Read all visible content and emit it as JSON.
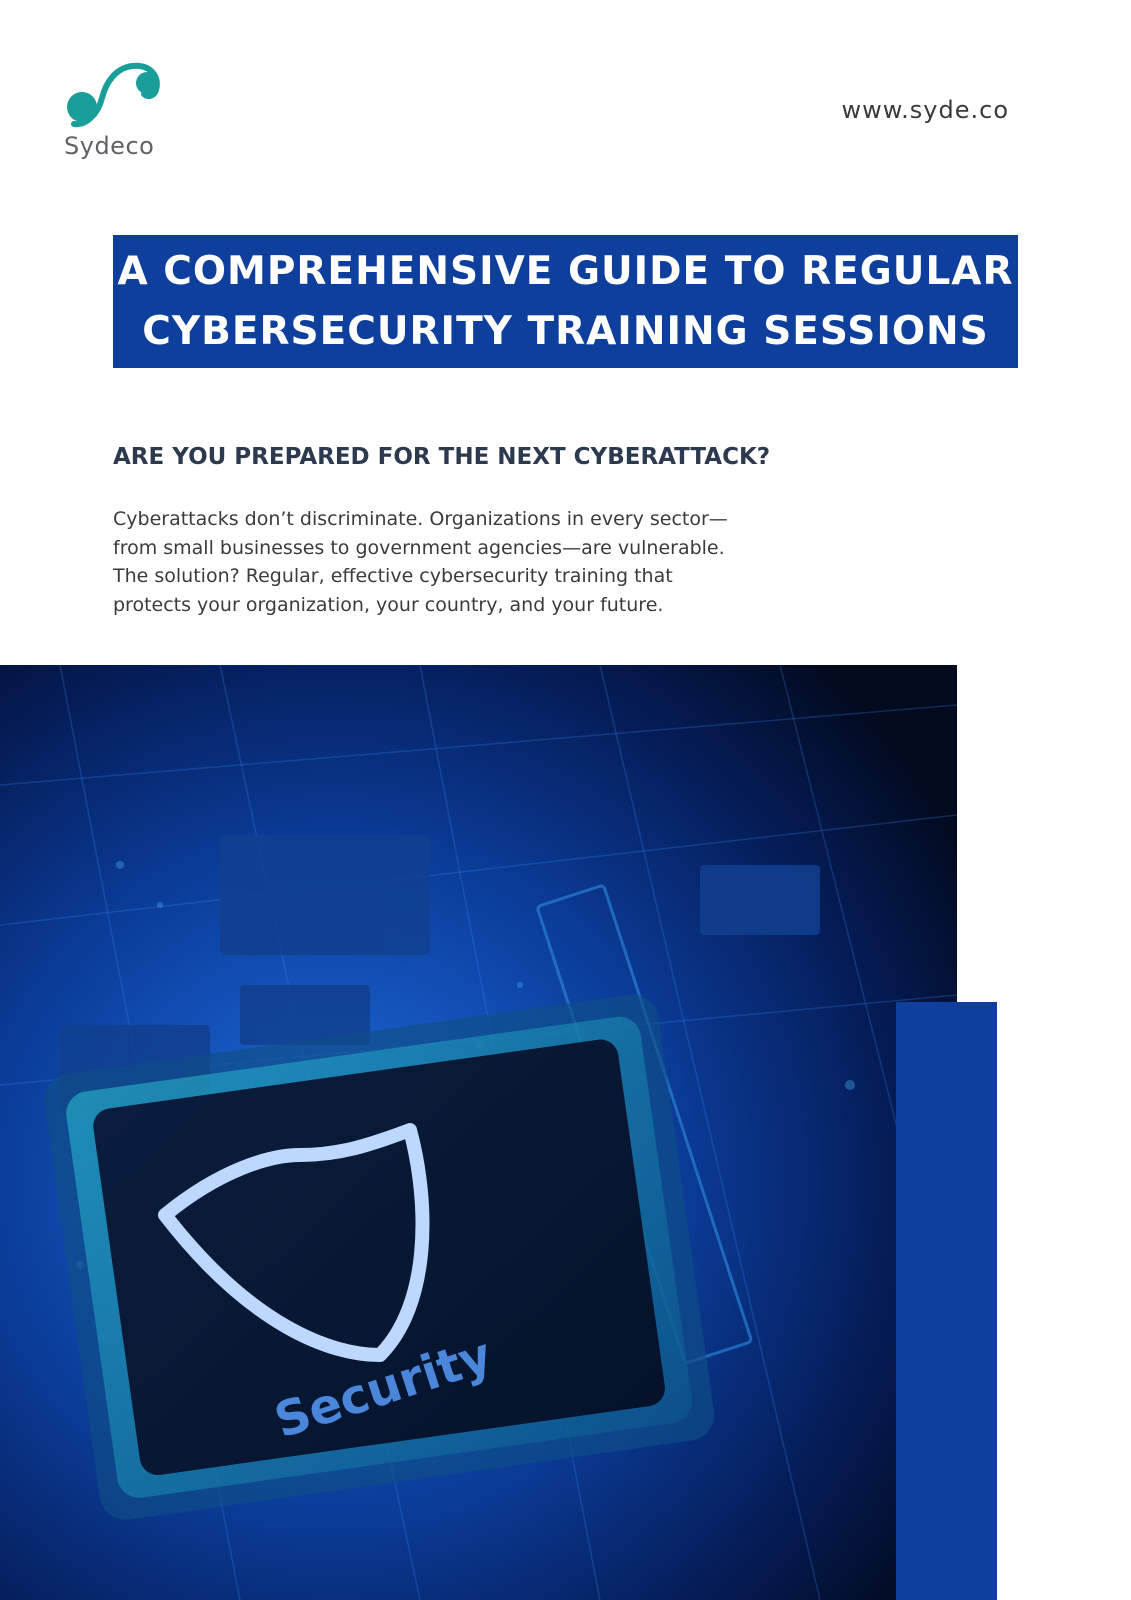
{
  "brand": {
    "name": "Sydeco",
    "url": "www.syde.co",
    "colors": {
      "primary": "#0f3f9c",
      "teal": "#1a9e9a",
      "heading": "#2c3a4f"
    }
  },
  "document": {
    "title_line_1": "A COMPREHENSIVE GUIDE TO REGULAR",
    "title_line_2": "CYBERSECURITY TRAINING SESSIONS",
    "subheading": "ARE YOU PREPARED FOR THE NEXT CYBERATTACK?",
    "intro_lines": [
      "Cyberattacks don’t discriminate. Organizations in every sector—",
      "from small businesses to government agencies—are vulnerable.",
      "The solution? Regular, effective cybersecurity training that",
      "protects your organization, your country, and your future."
    ]
  },
  "hero_image": {
    "chip_label": "Security",
    "icon": "shield-icon"
  }
}
